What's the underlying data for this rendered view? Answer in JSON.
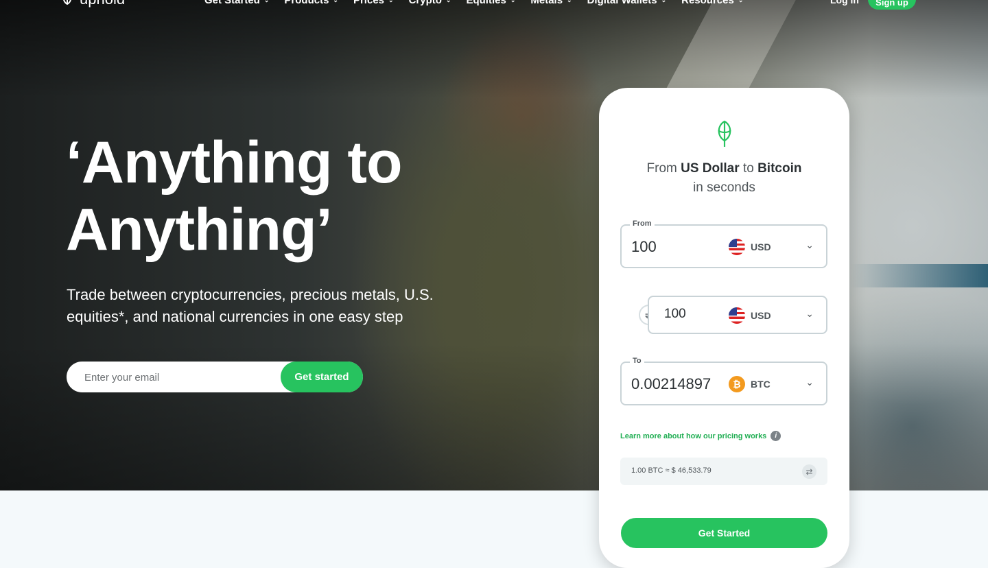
{
  "nav": {
    "logo_text": "uphold",
    "menu": [
      {
        "label": "Get Started"
      },
      {
        "label": "Products"
      },
      {
        "label": "Prices"
      },
      {
        "label": "Crypto"
      },
      {
        "label": "Equities"
      },
      {
        "label": "Metals"
      },
      {
        "label": "Digital Wallets"
      },
      {
        "label": "Resources"
      }
    ],
    "login": "Log in",
    "signup": "Sign up"
  },
  "hero": {
    "headline_1": "‘Anything to",
    "headline_2": "Anything’",
    "subtitle": "Trade between cryptocurrencies, precious metals, U.S. equities*, and national currencies in one easy step",
    "email_placeholder": "Enter your email",
    "cta": "Get started"
  },
  "widget": {
    "title_from": "From",
    "title_source": "US Dollar",
    "title_to": "to",
    "title_target": "Bitcoin",
    "title_line2": "in seconds",
    "from": {
      "label": "From",
      "amount": "100",
      "currency": "USD"
    },
    "middle": {
      "amount": "100",
      "currency": "USD"
    },
    "to": {
      "label": "To",
      "amount": "0.00214897",
      "currency": "BTC"
    },
    "pricing_link": "Learn more about how our pricing works",
    "rate": "1.00 BTC ≈ $ 46,533.79",
    "button": "Get Started"
  },
  "colors": {
    "accent": "#27c35f",
    "link": "#1fae52",
    "btc": "#f39a1e"
  }
}
